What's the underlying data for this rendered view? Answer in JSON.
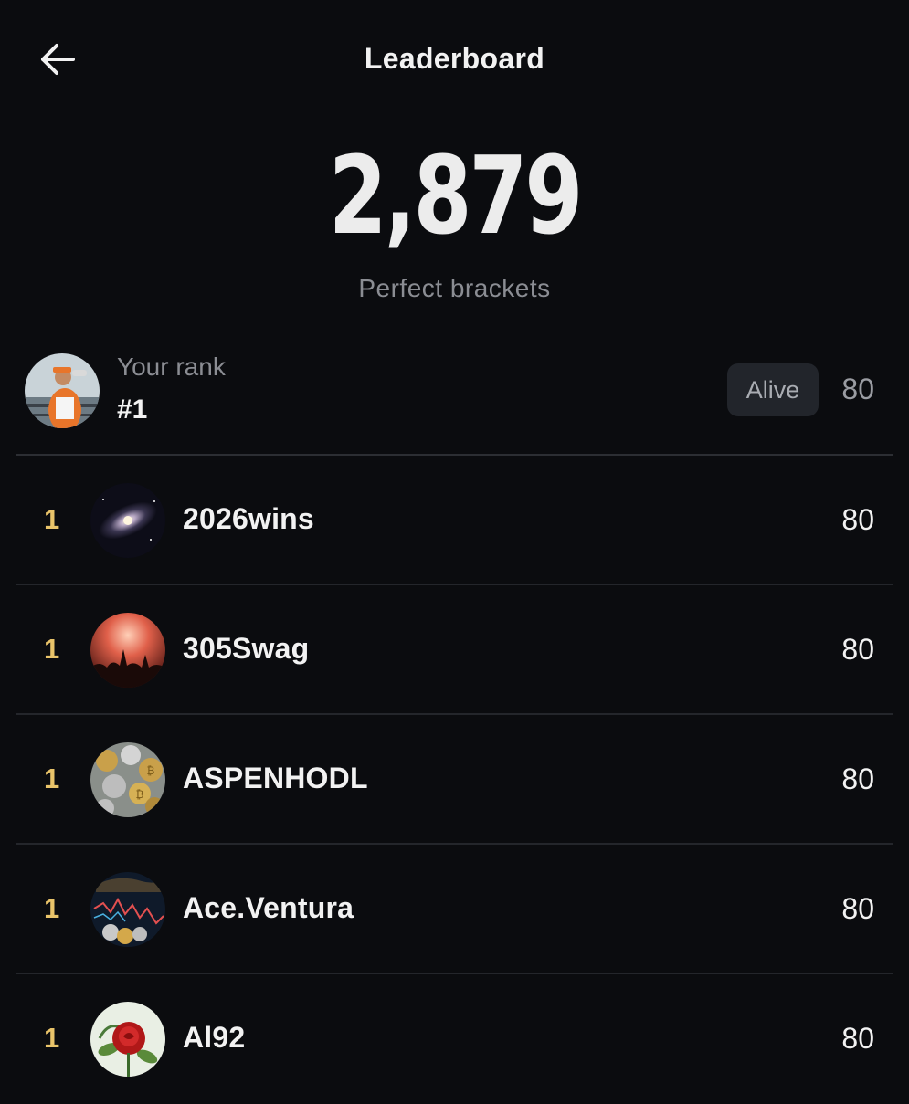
{
  "header": {
    "title": "Leaderboard",
    "back_icon": "arrow-left-icon"
  },
  "hero": {
    "count": "2,879",
    "label": "Perfect brackets"
  },
  "my_rank": {
    "label": "Your rank",
    "value": "#1",
    "status": "Alive",
    "score": "80",
    "avatar": "user-photo-avatar"
  },
  "rows": [
    {
      "rank": "1",
      "name": "2026wins",
      "score": "80",
      "avatar": "galaxy-avatar"
    },
    {
      "rank": "1",
      "name": "305Swag",
      "score": "80",
      "avatar": "concert-crowd-avatar"
    },
    {
      "rank": "1",
      "name": "ASPENHODL",
      "score": "80",
      "avatar": "crypto-coins-avatar"
    },
    {
      "rank": "1",
      "name": "Ace.Ventura",
      "score": "80",
      "avatar": "crypto-chart-avatar"
    },
    {
      "rank": "1",
      "name": "Al92",
      "score": "80",
      "avatar": "rose-avatar"
    }
  ],
  "colors": {
    "background": "#0b0c0f",
    "rank_gold": "#e9c46a",
    "badge_bg": "#22252b",
    "muted_text": "#8b8d93"
  }
}
